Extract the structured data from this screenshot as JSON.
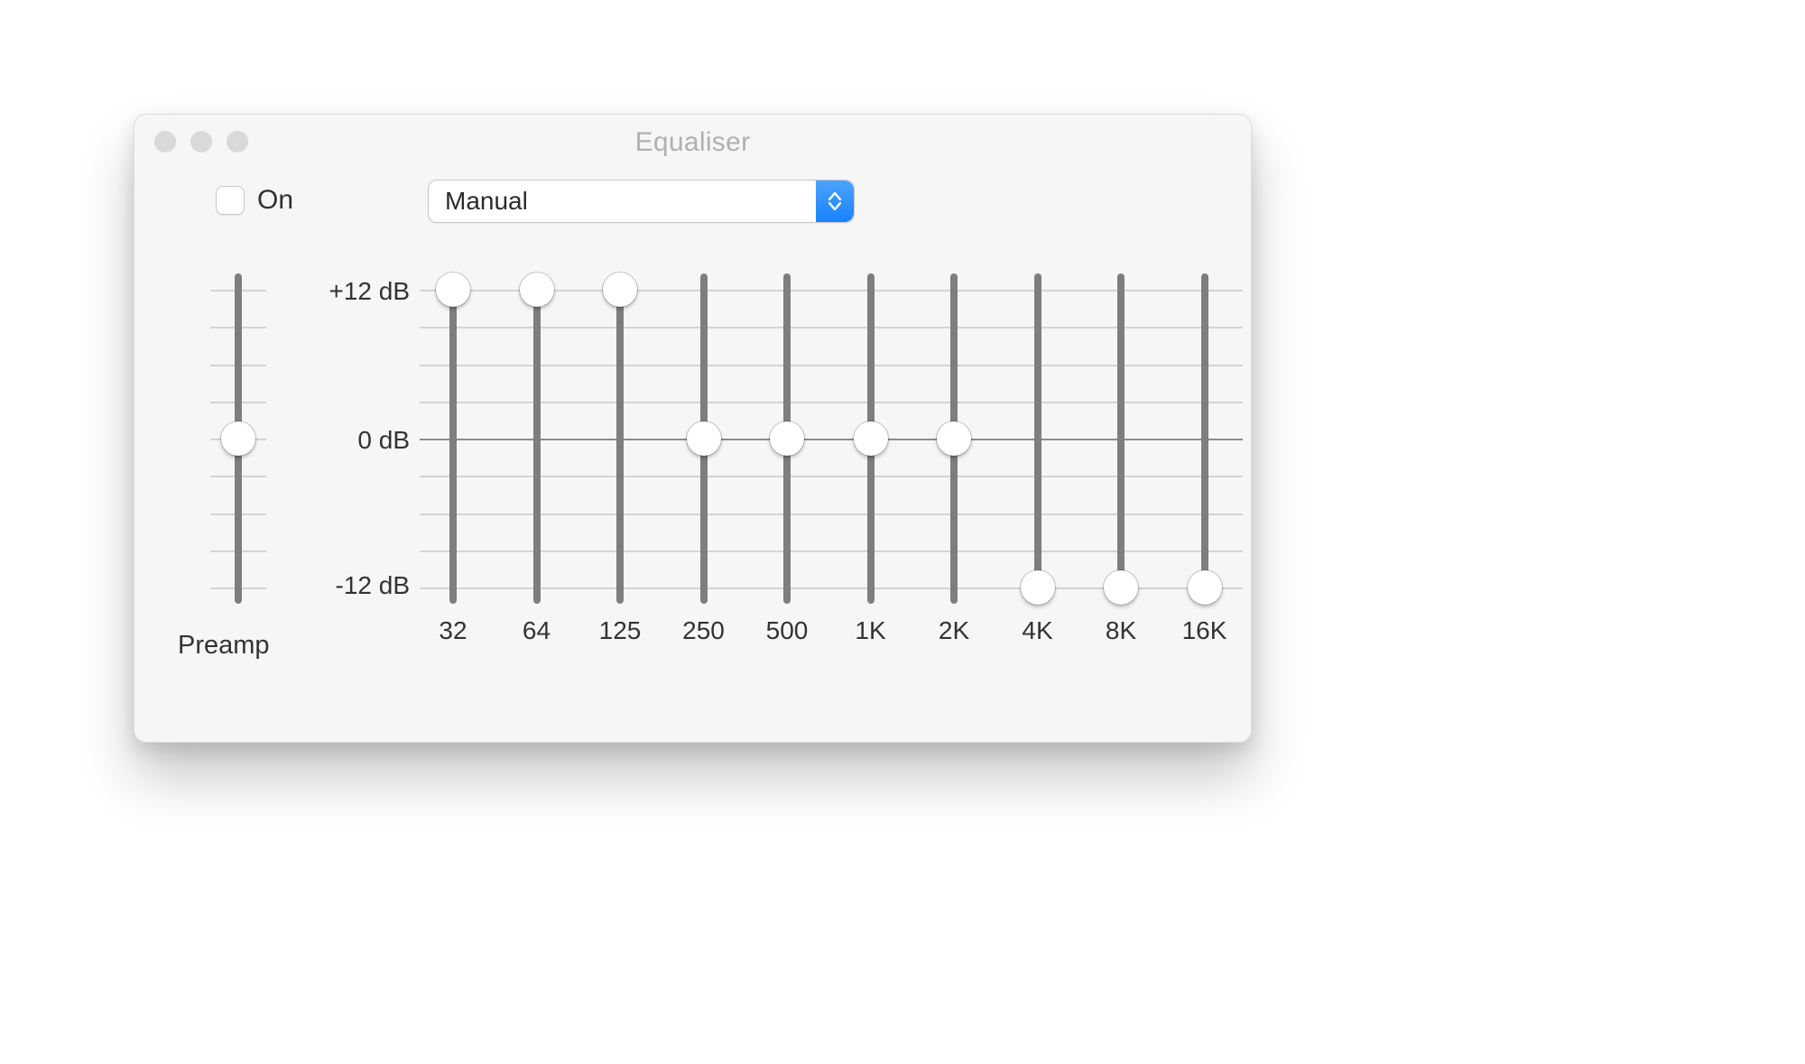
{
  "window": {
    "title": "Equaliser"
  },
  "controls": {
    "on_label": "On",
    "on_checked": false,
    "preset_selected": "Manual"
  },
  "scale": {
    "top": "+12 dB",
    "mid": "0 dB",
    "bot": "-12 dB",
    "min_db": -12,
    "max_db": 12
  },
  "preamp": {
    "label": "Preamp",
    "value_db": 0
  },
  "bands": [
    {
      "freq": "32",
      "value_db": 12
    },
    {
      "freq": "64",
      "value_db": 12
    },
    {
      "freq": "125",
      "value_db": 12
    },
    {
      "freq": "250",
      "value_db": 0
    },
    {
      "freq": "500",
      "value_db": 0
    },
    {
      "freq": "1K",
      "value_db": 0
    },
    {
      "freq": "2K",
      "value_db": 0
    },
    {
      "freq": "4K",
      "value_db": -12
    },
    {
      "freq": "8K",
      "value_db": -12
    },
    {
      "freq": "16K",
      "value_db": -12
    }
  ],
  "chart_data": {
    "type": "bar",
    "title": "Equaliser",
    "categories": [
      "32",
      "64",
      "125",
      "250",
      "500",
      "1K",
      "2K",
      "4K",
      "8K",
      "16K"
    ],
    "values": [
      12,
      12,
      12,
      0,
      0,
      0,
      0,
      -12,
      -12,
      -12
    ],
    "ylabel": "dB",
    "ylim": [
      -12,
      12
    ]
  }
}
